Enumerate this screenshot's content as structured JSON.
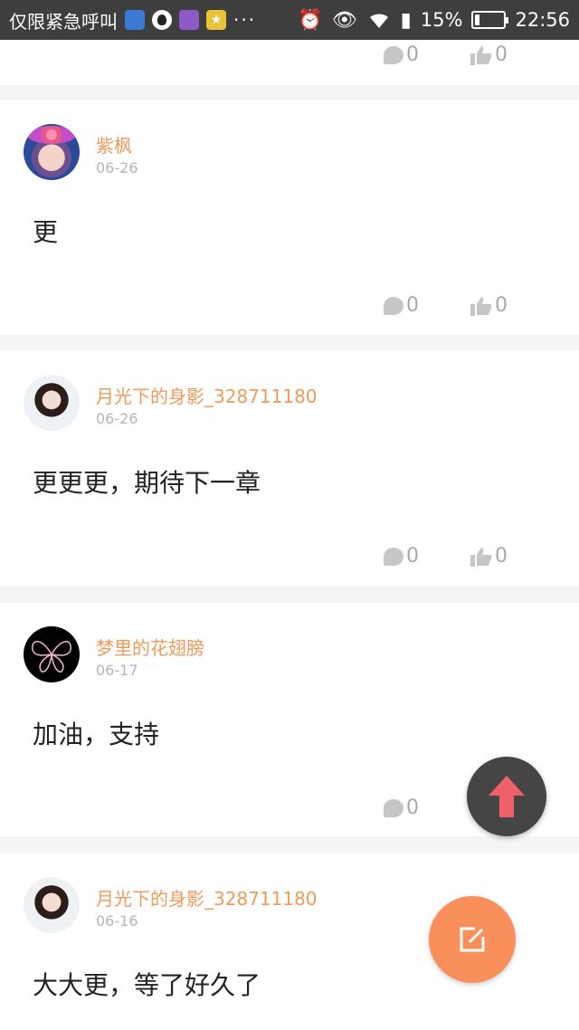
{
  "statusbar": {
    "carrier": "仅限紧急呼叫",
    "battery": "15%",
    "time": "22:56",
    "more": "···"
  },
  "top_partial": {
    "reply_count": "0",
    "like_count": "0"
  },
  "comments": [
    {
      "name": "紫枫",
      "date": "06-26",
      "text": "更",
      "reply_count": "0",
      "like_count": "0"
    },
    {
      "name": "月光下的身影_328711180",
      "date": "06-26",
      "text": "更更更，期待下一章",
      "reply_count": "0",
      "like_count": "0"
    },
    {
      "name": "梦里的花翅膀",
      "date": "06-17",
      "text": "加油，支持",
      "reply_count": "0",
      "like_count": ""
    },
    {
      "name": "月光下的身影_328711180",
      "date": "06-16",
      "text": "大大更，等了好久了",
      "reply_count": "",
      "like_count": ""
    }
  ],
  "colors": {
    "accent": "#f9905b",
    "name": "#f09a5c",
    "fab_dark": "#454545",
    "arrow": "#f0606a"
  },
  "icons": {
    "reply": "comment-bubble-icon",
    "like": "thumbs-up-icon",
    "scroll_top": "arrow-up-icon",
    "write": "edit-icon"
  }
}
